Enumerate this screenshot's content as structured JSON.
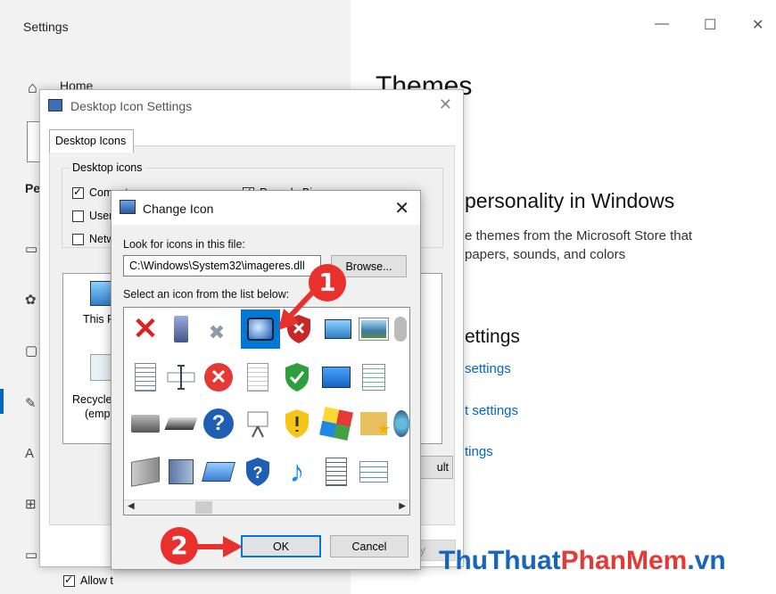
{
  "settings": {
    "app_title": "Settings",
    "home_label": "Home",
    "category_label": "Pe",
    "window_controls": [
      "—",
      "☐",
      "✕"
    ],
    "main": {
      "title": "Themes",
      "heading": "personality in Windows",
      "paragraph_line1": "e themes from the Microsoft Store that",
      "paragraph_line2": "papers, sounds, and colors",
      "related_heading": "ettings",
      "links": [
        "settings",
        "t settings",
        "tings"
      ]
    }
  },
  "desktop_icon_settings": {
    "title": "Desktop Icon Settings",
    "tab": "Desktop Icons",
    "group_label": "Desktop icons",
    "checkboxes": [
      {
        "label": "Computer",
        "checked": true
      },
      {
        "label": "User",
        "checked": false
      },
      {
        "label": "Netw",
        "checked": false
      },
      {
        "label": "Recycle Bin",
        "checked": true
      }
    ],
    "preview_items": [
      "This P",
      "Recycle",
      "(empt"
    ],
    "restore_button": "ult",
    "allow_themes_label": "Allow t",
    "apply_ghost": "ly"
  },
  "change_icon": {
    "title": "Change Icon",
    "look_label": "Look for icons in this file:",
    "path_value": "C:\\Windows\\System32\\imageres.dll",
    "browse_button": "Browse...",
    "select_label": "Select an icon from the list below:",
    "ok_button": "OK",
    "cancel_button": "Cancel",
    "icons": [
      [
        "red-x-icon",
        "phone-icon",
        "small-x-icon",
        "monitor-selected-icon",
        "shield-x-icon",
        "computer-icon",
        "picture-icon",
        "partial-icon"
      ],
      [
        "document-icon",
        "text-cursor-icon",
        "error-circle-icon",
        "blank-doc-icon",
        "shield-check-icon",
        "blue-screen-icon",
        "settings-doc-icon",
        ""
      ],
      [
        "printer-icon",
        "scanner-icon",
        "help-circle-icon",
        "presentation-icon",
        "shield-warning-icon",
        "apps-icon",
        "folder-star-icon",
        "globe-icon"
      ],
      [
        "drive-icon",
        "book-icon",
        "sd-card-icon",
        "shield-question-icon",
        "music-note-icon",
        "doc-lines-icon",
        "list-icon",
        ""
      ]
    ]
  },
  "annotations": {
    "badge1": "1",
    "badge2": "2"
  },
  "watermark": {
    "part1": "ThuThuat",
    "part2": "PhanMem",
    "part3": ".vn"
  },
  "colors": {
    "accent": "#0078d7",
    "badge": "#e8302c",
    "link": "#0067c0"
  }
}
